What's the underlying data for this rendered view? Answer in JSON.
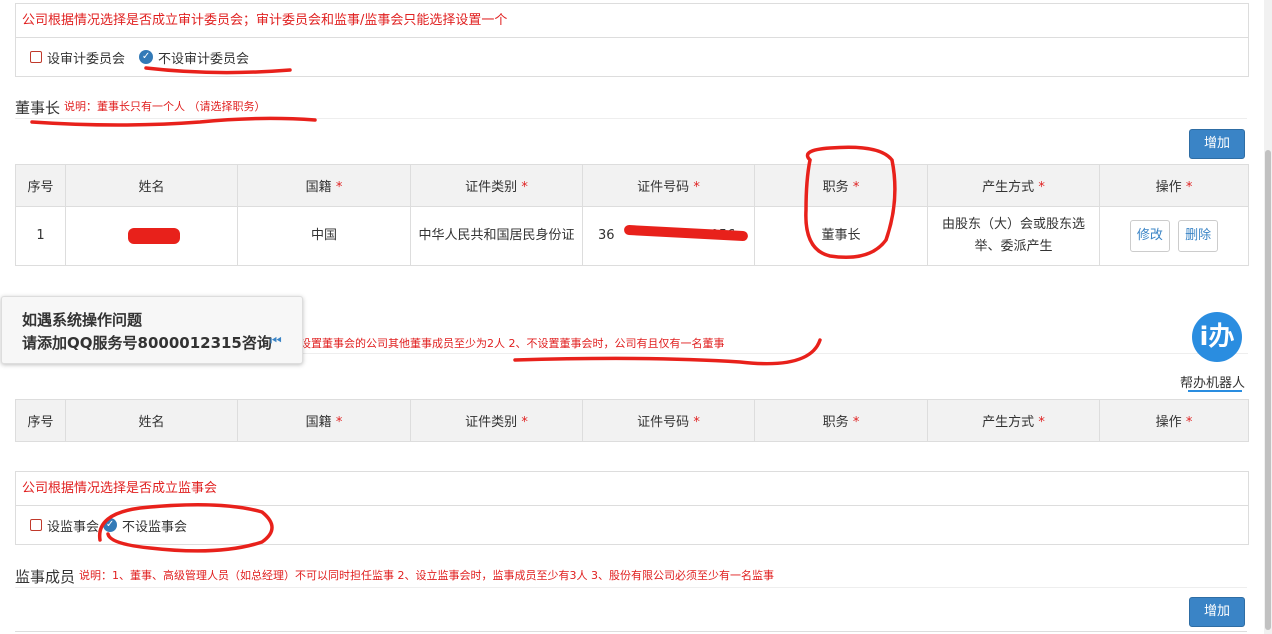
{
  "audit": {
    "notice": "公司根据情况选择是否成立审计委员会；审计委员会和监事/监事会只能选择设置一个",
    "option_set": "设审计委员会",
    "option_none": "不设审计委员会"
  },
  "chairman": {
    "title": "董事长",
    "note": "说明：董事长只有一个人     （请选择职务）",
    "add_label": "增加",
    "columns": [
      "序号",
      "姓名",
      "国籍",
      "证件类别",
      "证件号码",
      "职务",
      "产生方式",
      "操作"
    ],
    "required_mark": "*",
    "rows": [
      {
        "index": "1",
        "name": "",
        "nationality": "中国",
        "id_type": "中华人民共和国居民身份证",
        "id_number": "36",
        "id_number_tail": "056",
        "position": "董事长",
        "method": "由股东（大）会或股东选举、委派产生"
      }
    ],
    "edit_label": "修改",
    "delete_label": "删除"
  },
  "help": {
    "line1": "如遇系统操作问题",
    "line2": "请添加QQ服务号8000012315咨询",
    "arrow": "⏮"
  },
  "board": {
    "note": "设置董事会的公司其他董事成员至少为2人     2、不设置董事会时，公司有且仅有一名董事"
  },
  "robot": {
    "glyph": "i办",
    "label": "帮办机器人"
  },
  "supervisor_choice": {
    "notice": "公司根据情况选择是否成立监事会",
    "option_set": "设监事会",
    "option_none": "不设监事会"
  },
  "supervisors": {
    "title": "监事成员",
    "note": "说明：1、董事、高级管理人员（如总经理）不可以同时担任监事     2、设立监事会时，监事成员至少有3人     3、股份有限公司必须至少有一名监事",
    "add_label": "增加"
  },
  "colors": {
    "accent": "#3a84c6",
    "warning": "#e02020",
    "marker": "#e8211b"
  }
}
